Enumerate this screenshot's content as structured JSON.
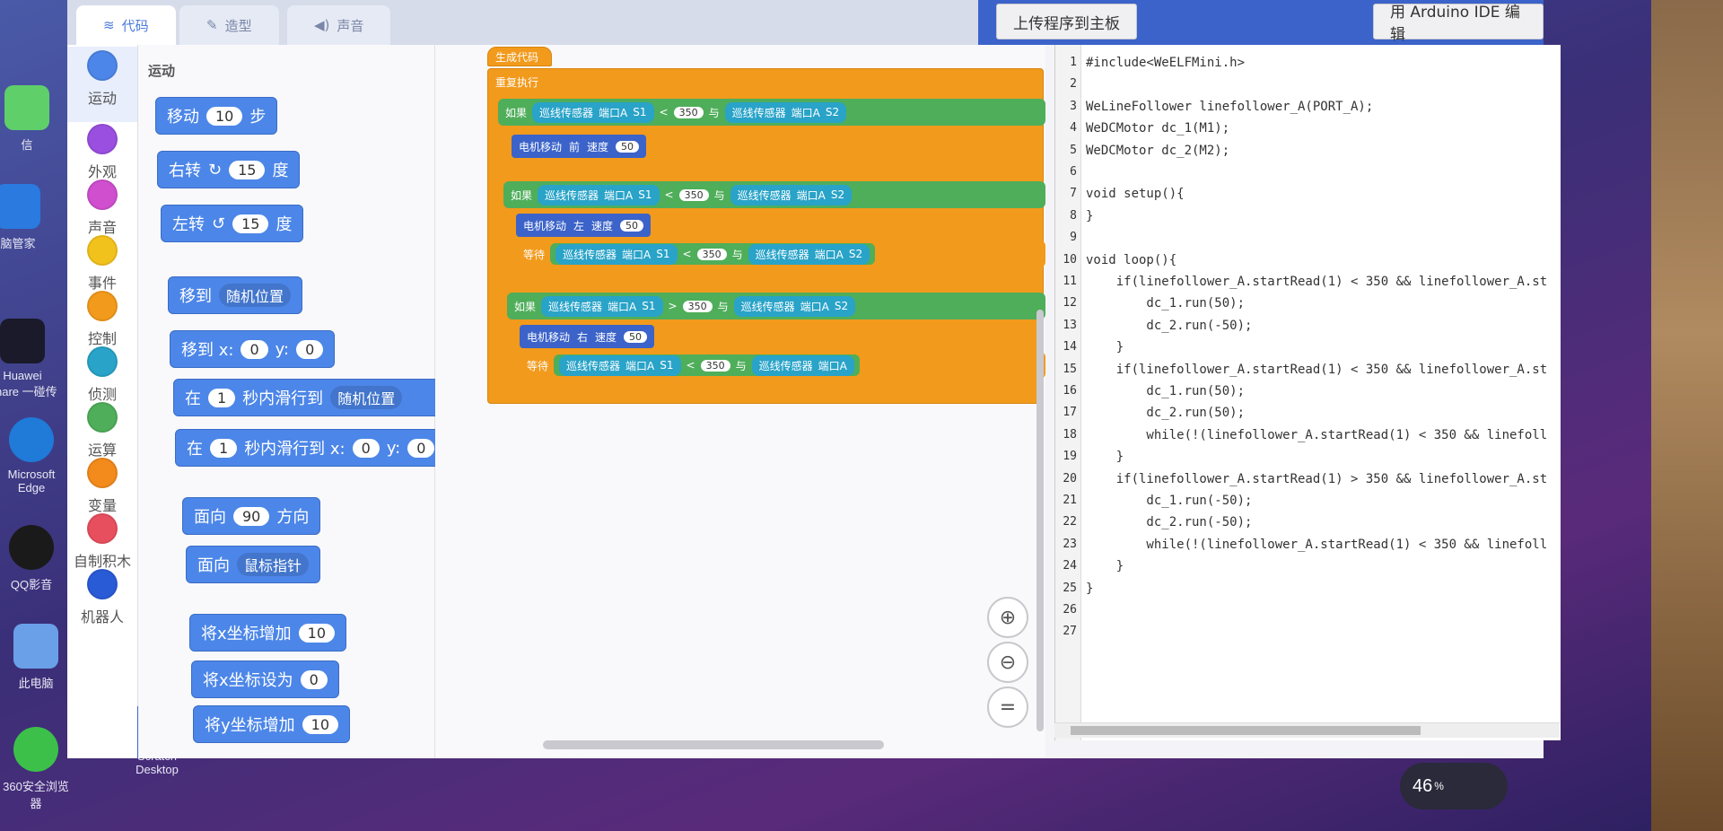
{
  "tabs": [
    {
      "label": "代码",
      "icon": "code-icon"
    },
    {
      "label": "造型",
      "icon": "brush-icon"
    },
    {
      "label": "声音",
      "icon": "speaker-icon"
    }
  ],
  "toolbar": {
    "upload_label": "上传程序到主板",
    "arduino_label": "用 Arduino IDE 编辑"
  },
  "categories": [
    {
      "label": "运动",
      "color": "#4c86e8"
    },
    {
      "label": "外观",
      "color": "#9a4fe0"
    },
    {
      "label": "声音",
      "color": "#cf4fcf"
    },
    {
      "label": "事件",
      "color": "#f2c21c"
    },
    {
      "label": "控制",
      "color": "#f29a1c"
    },
    {
      "label": "侦测",
      "color": "#29a3c8"
    },
    {
      "label": "运算",
      "color": "#4fae5a"
    },
    {
      "label": "变量",
      "color": "#f28a1c"
    },
    {
      "label": "自制积木",
      "color": "#e84f5e"
    },
    {
      "label": "机器人",
      "color": "#2a5bd6"
    }
  ],
  "palette": {
    "section_title": "运动",
    "blocks": {
      "move": {
        "text": "移动",
        "value": "10",
        "suffix": "步"
      },
      "turn_right": {
        "text": "右转",
        "value": "15",
        "suffix": "度"
      },
      "turn_left": {
        "text": "左转",
        "value": "15",
        "suffix": "度"
      },
      "goto": {
        "text": "移到",
        "menu": "随机位置"
      },
      "goto_xy": {
        "text": "移到 x:",
        "x": "0",
        "ylabel": "y:",
        "y": "0"
      },
      "glide": {
        "prefix": "在",
        "secs": "1",
        "text": "秒内滑行到",
        "menu": "随机位置"
      },
      "glide_xy": {
        "prefix": "在",
        "secs": "1",
        "text": "秒内滑行到 x:",
        "x": "0",
        "ylabel": "y:",
        "y": "0"
      },
      "point_dir": {
        "text": "面向",
        "value": "90",
        "suffix": "方向"
      },
      "point_towards": {
        "text": "面向",
        "menu": "鼠标指针"
      },
      "change_x": {
        "text": "将x坐标增加",
        "value": "10"
      },
      "set_x": {
        "text": "将x坐标设为",
        "value": "0"
      },
      "change_y": {
        "text": "将y坐标增加",
        "value": "10"
      }
    }
  },
  "script": {
    "hat": "生成代码",
    "forever": "重复执行",
    "sensor": "巡线传感器",
    "port": "端口A",
    "s1": "S1",
    "s2": "S2",
    "and": "与",
    "if_label": "如果",
    "wait_label": "等待",
    "cmp_lt": "<",
    "cmp_gt": ">",
    "threshold": "350",
    "motor_move": "电机移动",
    "dir_forward": "前",
    "dir_left": "左",
    "dir_right": "右",
    "speed": "速度",
    "speed_val": "50"
  },
  "code_lines": [
    "#include<WeELFMini.h>",
    "",
    "WeLineFollower linefollower_A(PORT_A);",
    "WeDCMotor dc_1(M1);",
    "WeDCMotor dc_2(M2);",
    "",
    "void setup(){",
    "}",
    "",
    "void loop(){",
    "    if(linefollower_A.startRead(1) < 350 && linefollower_A.st",
    "        dc_1.run(50);",
    "        dc_2.run(-50);",
    "    }",
    "    if(linefollower_A.startRead(1) < 350 && linefollower_A.st",
    "        dc_1.run(50);",
    "        dc_2.run(50);",
    "        while(!(linefollower_A.startRead(1) < 350 && linefoll",
    "    }",
    "    if(linefollower_A.startRead(1) > 350 && linefollower_A.st",
    "        dc_1.run(-50);",
    "        dc_2.run(-50);",
    "        while(!(linefollower_A.startRead(1) < 350 && linefoll",
    "    }",
    "}",
    "",
    ""
  ],
  "desktop": {
    "icons": [
      {
        "label": "信"
      },
      {
        "label": "脑管家"
      },
      {
        "label": "Huawei Share 一碰传"
      },
      {
        "label": "Microsoft Edge"
      },
      {
        "label": "QQ影音"
      },
      {
        "label": "此电脑"
      },
      {
        "label": "360安全浏览器"
      },
      {
        "label": "Scratch Desktop"
      }
    ],
    "battery": "46"
  }
}
